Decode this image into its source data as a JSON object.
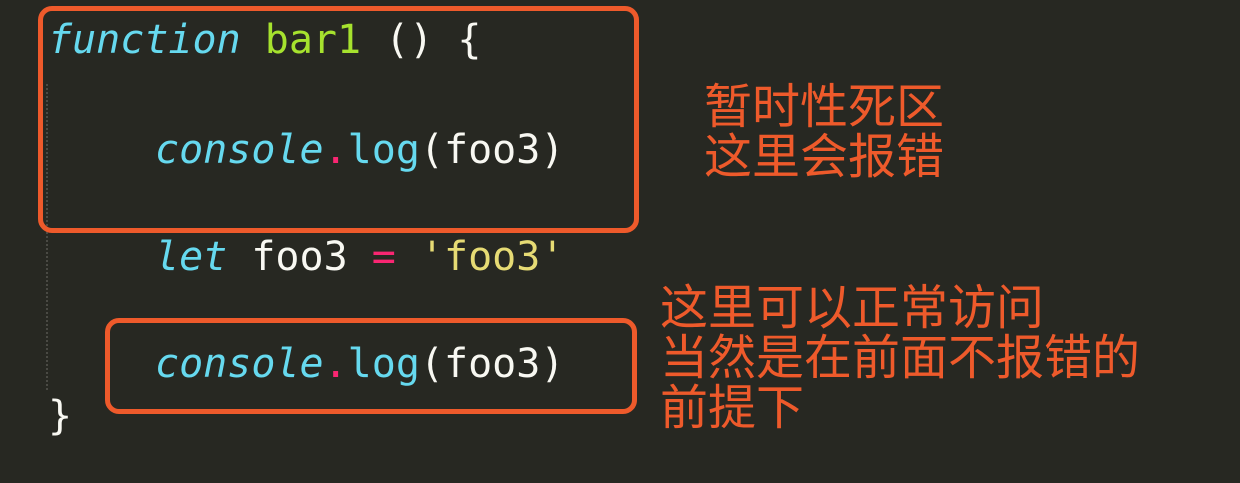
{
  "code": {
    "line1": {
      "keyword": "function",
      "name": "bar1",
      "rest": " () {"
    },
    "line2": {
      "object": "console",
      "dot": ".",
      "method": "log",
      "args": "(foo3)"
    },
    "line3": {
      "keyword": "let",
      "variable": " foo3 ",
      "operator": "=",
      "string": "'foo3'"
    },
    "line4": {
      "object": "console",
      "dot": ".",
      "method": "log",
      "args": "(foo3)"
    },
    "line5": {
      "brace": "}"
    }
  },
  "annotations": {
    "tdz_line1": "暂时性死区",
    "tdz_line2": "这里会报错",
    "ok_line1": "这里可以正常访问",
    "ok_line2": "当然是在前面不报错的",
    "ok_line3": "前提下"
  },
  "colors": {
    "background": "#272822",
    "keyword": "#66d9ef",
    "function_name": "#a6e22e",
    "operator": "#f92672",
    "string": "#e6db74",
    "annotation": "#ee5a2b"
  }
}
